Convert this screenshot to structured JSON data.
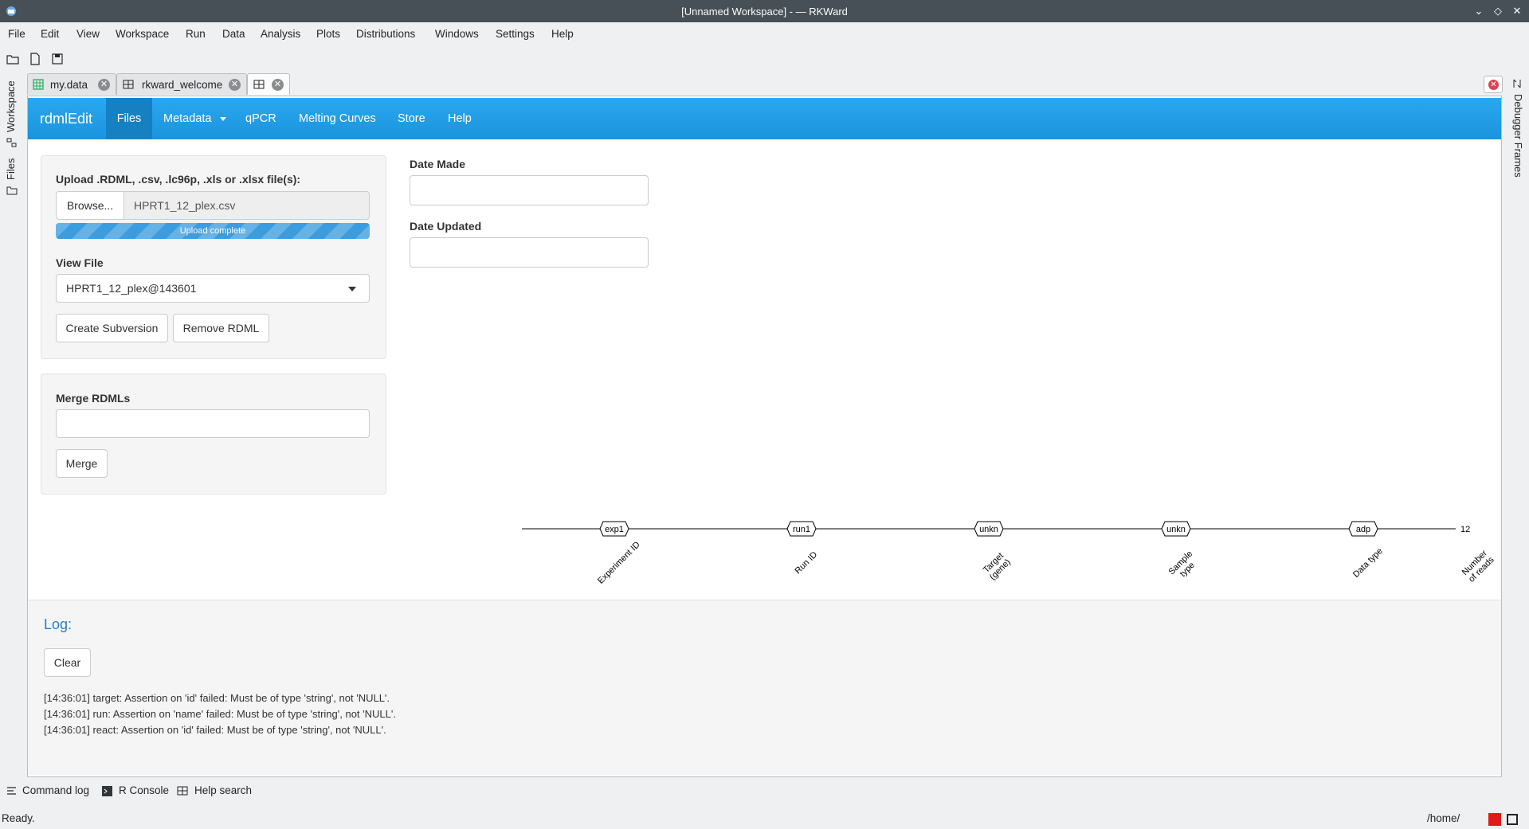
{
  "window": {
    "title": "[Unnamed Workspace] - — RKWard"
  },
  "menubar": {
    "items": [
      "File",
      "Edit",
      "View",
      "Workspace",
      "Run",
      "Data",
      "Analysis",
      "Plots",
      "Distributions",
      "Windows",
      "Settings",
      "Help"
    ]
  },
  "toolbar": {
    "icons": [
      "open-folder-icon",
      "new-script-icon",
      "save-icon"
    ]
  },
  "left_sidebar": {
    "items": [
      "Workspace",
      "Files"
    ]
  },
  "right_sidebar": {
    "items": [
      "Debugger Frames"
    ]
  },
  "tabs": [
    {
      "label": "my.data",
      "icon": "table-icon"
    },
    {
      "label": "rkward_welcome",
      "icon": "help-icon"
    },
    {
      "label": "",
      "icon": "help-icon"
    }
  ],
  "navbar": {
    "brand": "rdmlEdit",
    "items": [
      "Files",
      "Metadata",
      "qPCR",
      "Melting Curves",
      "Store",
      "Help"
    ],
    "active": "Files"
  },
  "upload": {
    "label": "Upload .RDML, .csv, .lc96p, .xls or .xlsx file(s):",
    "browse_label": "Browse...",
    "filename": "HPRT1_12_plex.csv",
    "progress_text": "Upload complete",
    "progress_value": 1.0
  },
  "view_file": {
    "label": "View File",
    "selected": "HPRT1_12_plex@143601"
  },
  "file_buttons": {
    "create_subversion": "Create Subversion",
    "remove_rdml": "Remove RDML"
  },
  "merge": {
    "label": "Merge RDMLs",
    "value": "",
    "button": "Merge"
  },
  "dates": {
    "made_label": "Date Made",
    "made_value": "",
    "updated_label": "Date Updated",
    "updated_value": ""
  },
  "tree": {
    "nodes": [
      "exp1",
      "run1",
      "unkn",
      "unkn",
      "adp"
    ],
    "end_value": "12",
    "axis_labels": [
      [
        "Experiment ID"
      ],
      [
        "Run ID"
      ],
      [
        "Target",
        "(gene)"
      ],
      [
        "Sample",
        "type"
      ],
      [
        "Data type"
      ],
      [
        "Number",
        "of reads"
      ]
    ]
  },
  "log": {
    "title": "Log:",
    "clear_label": "Clear",
    "lines": [
      "[14:36:01] target: Assertion on 'id' failed: Must be of type 'string', not 'NULL'.",
      "[14:36:01] run: Assertion on 'name' failed: Must be of type 'string', not 'NULL'.",
      "[14:36:01] react: Assertion on 'id' failed: Must be of type 'string', not 'NULL'."
    ]
  },
  "bottom_tools": [
    "Command log",
    "R Console",
    "Help search"
  ],
  "status": {
    "text": "Ready.",
    "path": "/home/"
  }
}
